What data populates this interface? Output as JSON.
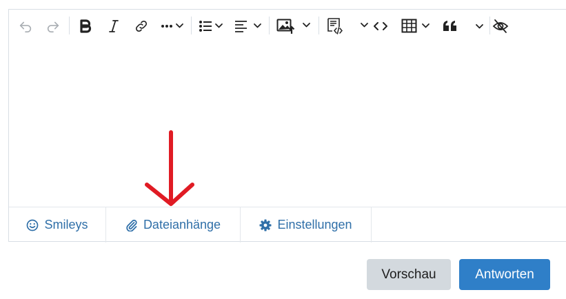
{
  "toolbar": {
    "icons": {
      "undo": "undo-icon",
      "redo": "redo-icon",
      "bold": "bold-icon",
      "italic": "italic-icon",
      "link": "link-icon",
      "more": "more-icon",
      "list": "list-icon",
      "align": "align-icon",
      "image": "image-icon",
      "code_block": "code-block-icon",
      "code": "code-icon",
      "table": "table-icon",
      "quote": "quote-icon",
      "spoiler": "eye-slash-icon"
    },
    "undo_enabled": false,
    "redo_enabled": false
  },
  "editor": {
    "content": ""
  },
  "footer_tabs": [
    {
      "label": "Smileys",
      "icon": "smiley-icon"
    },
    {
      "label": "Dateianhänge",
      "icon": "paperclip-icon"
    },
    {
      "label": "Einstellungen",
      "icon": "gear-icon"
    }
  ],
  "buttons": {
    "preview": "Vorschau",
    "reply": "Antworten"
  },
  "colors": {
    "link": "#2f6fa8",
    "primary": "#2f7fc8",
    "secondary": "#d3d9de",
    "annotation_arrow": "#e01b24"
  }
}
